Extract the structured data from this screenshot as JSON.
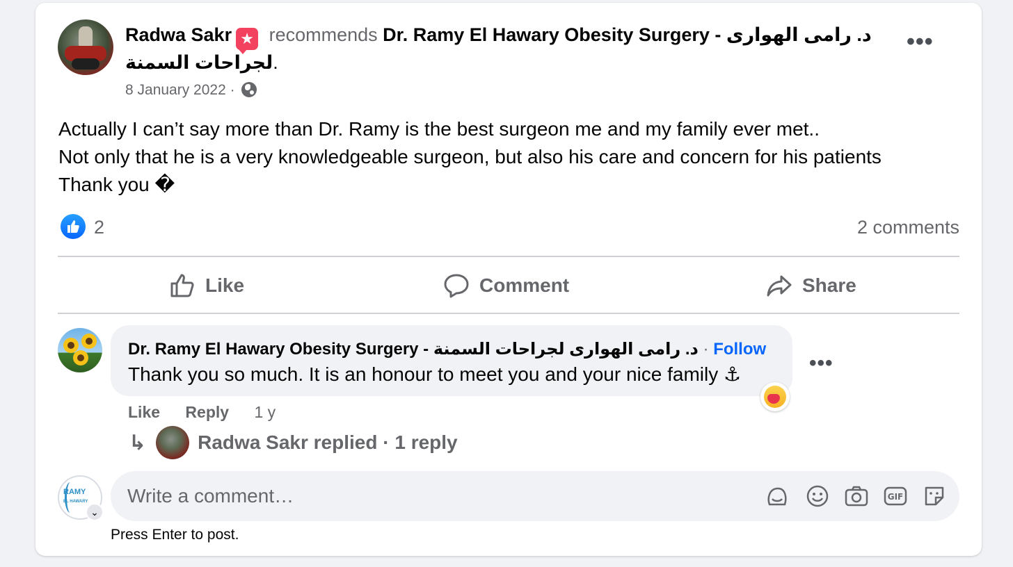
{
  "post": {
    "author": "Radwa Sakr",
    "verb": "recommends",
    "page_name_line1": "Dr. Ramy El Hawary Obesity Surgery - د. رامى الهوارى",
    "page_name_line2": "لجراحات السمنة",
    "period": ".",
    "date": "8 January 2022",
    "date_sep": "·",
    "body_line1": "Actually I can’t say more than Dr. Ramy is the best surgeon me and my family ever met..",
    "body_line2": "Not only that he is a very knowledgeable surgeon, but also his care and concern for his patients",
    "body_line3": "Thank you �",
    "reaction_count": "2",
    "comment_count": "2 comments",
    "more_label": "•••"
  },
  "actions": {
    "like": "Like",
    "comment": "Comment",
    "share": "Share"
  },
  "comment": {
    "author": "Dr. Ramy El Hawary Obesity Surgery - د. رامى الهوارى لجراحات السمنة",
    "sep": "·",
    "follow": "Follow",
    "text": "Thank you so much. It is an honour to meet you and your nice family ⚓",
    "like": "Like",
    "reply": "Reply",
    "age": "1 y",
    "more_label": "•••",
    "reply_summary": "Radwa Sakr replied · 1 reply"
  },
  "composer": {
    "avatar_text_1": "RAMY",
    "avatar_text_2": "EL HAWARY",
    "placeholder": "Write a comment…",
    "hint": "Press Enter to post.",
    "tools": [
      "avatar-sticker-icon",
      "emoji-icon",
      "camera-icon",
      "gif-icon",
      "sticker-icon"
    ]
  },
  "colors": {
    "accent": "#0866ff",
    "muted": "#65676b",
    "recommend_badge": "#f3425f",
    "bubble": "#f0f2f5"
  }
}
